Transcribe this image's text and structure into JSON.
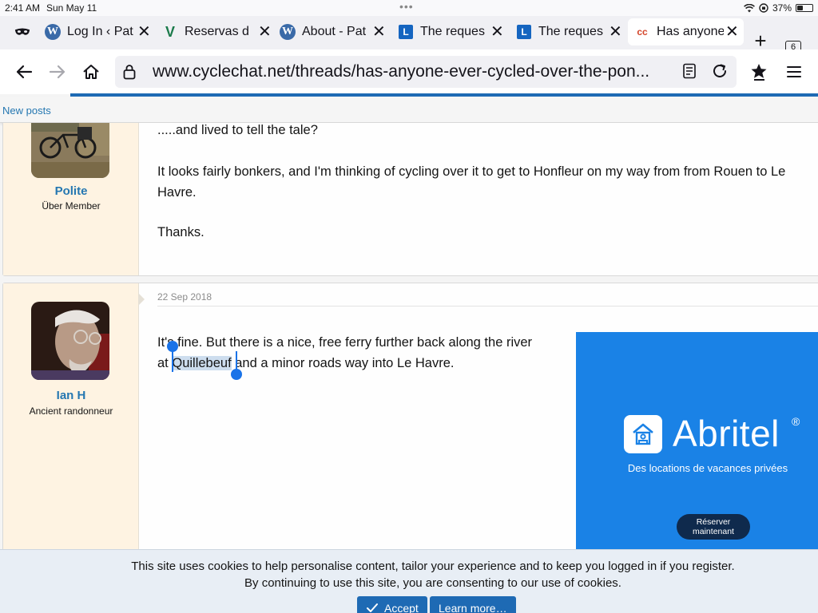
{
  "status_bar": {
    "time": "2:41 AM",
    "date": "Sun May 11",
    "dots": "•••",
    "battery_percent": "37%",
    "battery_level": 0.37
  },
  "tabs": [
    {
      "label": "",
      "icon": "mask-icon"
    },
    {
      "label": "Log In ‹ Pat",
      "icon": "wordpress-icon"
    },
    {
      "label": "Reservas d",
      "icon": "v-logo-icon"
    },
    {
      "label": "About - Pat",
      "icon": "wordpress-icon"
    },
    {
      "label": "The reques",
      "icon": "l-logo-icon"
    },
    {
      "label": "The reques",
      "icon": "l-logo-icon"
    },
    {
      "label": "Has anyone",
      "icon": "cyclechat-icon",
      "active": true
    }
  ],
  "tab_count": "6",
  "favicon_text": {
    "wp": "W",
    "l": "L",
    "v": "V",
    "cc": "cc"
  },
  "url": "www.cyclechat.net/threads/has-anyone-ever-cycled-over-the-pon...",
  "nav": {
    "new_posts": "New posts"
  },
  "posts": [
    {
      "username": "Polite",
      "user_title": "Über Member",
      "paragraphs": [
        ".....and lived to tell the tale?",
        "It looks fairly bonkers, and I'm thinking of cycling over it to get to Honfleur on my way from from Rouen to Le",
        "Havre.",
        "Thanks."
      ]
    },
    {
      "username": "Ian H",
      "user_title": "Ancient randonneur",
      "date": "22 Sep 2018",
      "line1": "It's fine. But there is a nice, free ferry further back along the river",
      "line2_prefix": "at ",
      "line2_selected": "Quillebeuf",
      "line2_suffix": " and a minor roads way into Le Havre."
    }
  ],
  "ad": {
    "brand": "Abritel",
    "registered": "®",
    "tagline": "Des locations de vacances privées",
    "cta_line1": "Réserver",
    "cta_line2": "maintenant",
    "color": "#1a82e6"
  },
  "cookie": {
    "line1": "This site uses cookies to help personalise content, tailor your experience and to keep you logged in if you register.",
    "line2": "By continuing to use this site, you are consenting to our use of cookies.",
    "accept_label": "Accept",
    "learn_more_label": "Learn more…"
  },
  "colors": {
    "link": "#2577b1",
    "accent": "#1e6ab4",
    "user_col": "#fef3e2"
  }
}
